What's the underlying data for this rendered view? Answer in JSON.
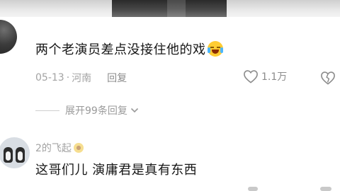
{
  "comment1": {
    "text": "两个老演员差点没接住他的戏",
    "emoji": "laughing-crying-emoji",
    "date": "05-13",
    "separator": "·",
    "location": "河南",
    "reply_label": "回复",
    "like_count": "1.1万"
  },
  "expand_replies": {
    "label": "展开99条回复"
  },
  "comment2": {
    "username": "2的飞起",
    "badge": "sunflower-icon",
    "text": "这哥们儿 演庸君是真有东西"
  },
  "colors": {
    "text_primary": "#161616",
    "text_meta": "#a3a3a3",
    "emoji_yellow": "#ffcc33"
  }
}
